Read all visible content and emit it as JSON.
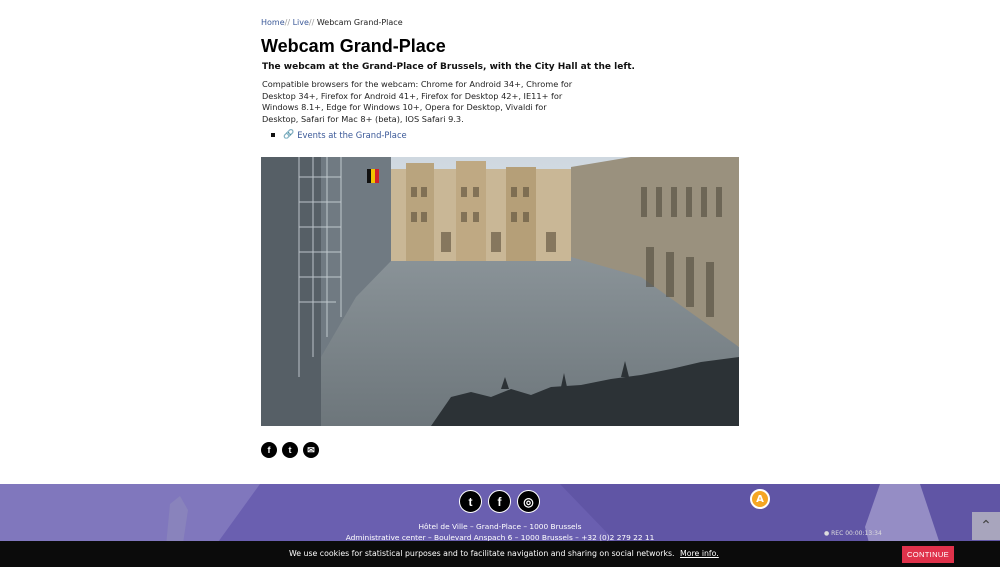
{
  "breadcrumb": {
    "home": "Home",
    "sep1": "//",
    "live": "Live",
    "sep2": "//",
    "current": "Webcam Grand-Place"
  },
  "page": {
    "title": "Webcam Grand-Place",
    "subtitle": "The webcam at the Grand-Place of Brussels, with the City Hall at the left.",
    "description": "Compatible browsers for the webcam: Chrome for Android 34+, Chrome for Desktop 34+, Firefox for Android 41+, Firefox for Desktop 42+, IE11+ for Windows 8.1+, Edge for Windows 10+, Opera for Desktop, Vivaldi for Desktop, Safari for Mac 8+ (beta), IOS Safari 9.3.",
    "links": [
      {
        "label": "Events at the Grand-Place"
      }
    ]
  },
  "share": {
    "facebook": "f",
    "twitter": "t",
    "email": "✉"
  },
  "footer": {
    "social": {
      "twitter": "t",
      "facebook": "f",
      "instagram": "◎"
    },
    "address1": "Hôtel de Ville – Grand-Place – 1000 Brussels",
    "address2": "Administrative center – Boulevard Anspach 6 – 1000 Brussels – +32 (0)2 279 22 11",
    "badge": "A",
    "rec": "● REC 00:00:13:34",
    "to_top": "⌃"
  },
  "cookie": {
    "text": "We use cookies for statistical purposes and to facilitate navigation and sharing on social networks.",
    "more": "More info.",
    "button": "CONTINUE"
  },
  "colors": {
    "link": "#3b5998",
    "footer": "#6a5fb0",
    "cookie_button": "#e0324b"
  }
}
